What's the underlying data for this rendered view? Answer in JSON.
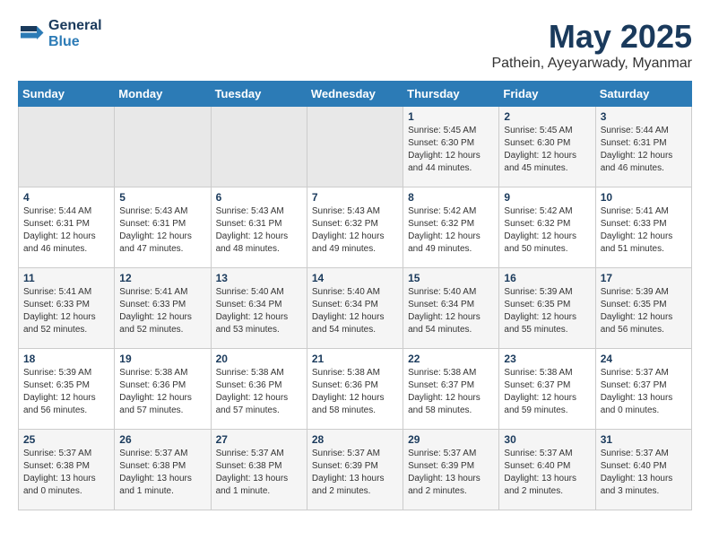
{
  "logo": {
    "line1": "General",
    "line2": "Blue"
  },
  "title": "May 2025",
  "subtitle": "Pathein, Ayeyarwady, Myanmar",
  "weekdays": [
    "Sunday",
    "Monday",
    "Tuesday",
    "Wednesday",
    "Thursday",
    "Friday",
    "Saturday"
  ],
  "weeks": [
    [
      {
        "day": "",
        "info": ""
      },
      {
        "day": "",
        "info": ""
      },
      {
        "day": "",
        "info": ""
      },
      {
        "day": "",
        "info": ""
      },
      {
        "day": "1",
        "info": "Sunrise: 5:45 AM\nSunset: 6:30 PM\nDaylight: 12 hours\nand 44 minutes."
      },
      {
        "day": "2",
        "info": "Sunrise: 5:45 AM\nSunset: 6:30 PM\nDaylight: 12 hours\nand 45 minutes."
      },
      {
        "day": "3",
        "info": "Sunrise: 5:44 AM\nSunset: 6:31 PM\nDaylight: 12 hours\nand 46 minutes."
      }
    ],
    [
      {
        "day": "4",
        "info": "Sunrise: 5:44 AM\nSunset: 6:31 PM\nDaylight: 12 hours\nand 46 minutes."
      },
      {
        "day": "5",
        "info": "Sunrise: 5:43 AM\nSunset: 6:31 PM\nDaylight: 12 hours\nand 47 minutes."
      },
      {
        "day": "6",
        "info": "Sunrise: 5:43 AM\nSunset: 6:31 PM\nDaylight: 12 hours\nand 48 minutes."
      },
      {
        "day": "7",
        "info": "Sunrise: 5:43 AM\nSunset: 6:32 PM\nDaylight: 12 hours\nand 49 minutes."
      },
      {
        "day": "8",
        "info": "Sunrise: 5:42 AM\nSunset: 6:32 PM\nDaylight: 12 hours\nand 49 minutes."
      },
      {
        "day": "9",
        "info": "Sunrise: 5:42 AM\nSunset: 6:32 PM\nDaylight: 12 hours\nand 50 minutes."
      },
      {
        "day": "10",
        "info": "Sunrise: 5:41 AM\nSunset: 6:33 PM\nDaylight: 12 hours\nand 51 minutes."
      }
    ],
    [
      {
        "day": "11",
        "info": "Sunrise: 5:41 AM\nSunset: 6:33 PM\nDaylight: 12 hours\nand 52 minutes."
      },
      {
        "day": "12",
        "info": "Sunrise: 5:41 AM\nSunset: 6:33 PM\nDaylight: 12 hours\nand 52 minutes."
      },
      {
        "day": "13",
        "info": "Sunrise: 5:40 AM\nSunset: 6:34 PM\nDaylight: 12 hours\nand 53 minutes."
      },
      {
        "day": "14",
        "info": "Sunrise: 5:40 AM\nSunset: 6:34 PM\nDaylight: 12 hours\nand 54 minutes."
      },
      {
        "day": "15",
        "info": "Sunrise: 5:40 AM\nSunset: 6:34 PM\nDaylight: 12 hours\nand 54 minutes."
      },
      {
        "day": "16",
        "info": "Sunrise: 5:39 AM\nSunset: 6:35 PM\nDaylight: 12 hours\nand 55 minutes."
      },
      {
        "day": "17",
        "info": "Sunrise: 5:39 AM\nSunset: 6:35 PM\nDaylight: 12 hours\nand 56 minutes."
      }
    ],
    [
      {
        "day": "18",
        "info": "Sunrise: 5:39 AM\nSunset: 6:35 PM\nDaylight: 12 hours\nand 56 minutes."
      },
      {
        "day": "19",
        "info": "Sunrise: 5:38 AM\nSunset: 6:36 PM\nDaylight: 12 hours\nand 57 minutes."
      },
      {
        "day": "20",
        "info": "Sunrise: 5:38 AM\nSunset: 6:36 PM\nDaylight: 12 hours\nand 57 minutes."
      },
      {
        "day": "21",
        "info": "Sunrise: 5:38 AM\nSunset: 6:36 PM\nDaylight: 12 hours\nand 58 minutes."
      },
      {
        "day": "22",
        "info": "Sunrise: 5:38 AM\nSunset: 6:37 PM\nDaylight: 12 hours\nand 58 minutes."
      },
      {
        "day": "23",
        "info": "Sunrise: 5:38 AM\nSunset: 6:37 PM\nDaylight: 12 hours\nand 59 minutes."
      },
      {
        "day": "24",
        "info": "Sunrise: 5:37 AM\nSunset: 6:37 PM\nDaylight: 13 hours\nand 0 minutes."
      }
    ],
    [
      {
        "day": "25",
        "info": "Sunrise: 5:37 AM\nSunset: 6:38 PM\nDaylight: 13 hours\nand 0 minutes."
      },
      {
        "day": "26",
        "info": "Sunrise: 5:37 AM\nSunset: 6:38 PM\nDaylight: 13 hours\nand 1 minute."
      },
      {
        "day": "27",
        "info": "Sunrise: 5:37 AM\nSunset: 6:38 PM\nDaylight: 13 hours\nand 1 minute."
      },
      {
        "day": "28",
        "info": "Sunrise: 5:37 AM\nSunset: 6:39 PM\nDaylight: 13 hours\nand 2 minutes."
      },
      {
        "day": "29",
        "info": "Sunrise: 5:37 AM\nSunset: 6:39 PM\nDaylight: 13 hours\nand 2 minutes."
      },
      {
        "day": "30",
        "info": "Sunrise: 5:37 AM\nSunset: 6:40 PM\nDaylight: 13 hours\nand 2 minutes."
      },
      {
        "day": "31",
        "info": "Sunrise: 5:37 AM\nSunset: 6:40 PM\nDaylight: 13 hours\nand 3 minutes."
      }
    ]
  ]
}
